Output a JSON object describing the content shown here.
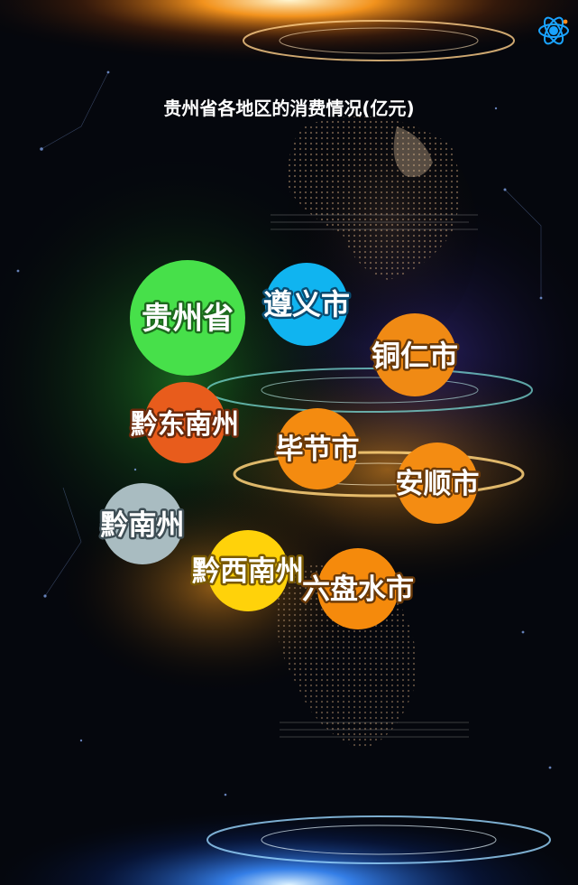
{
  "chart_data": {
    "type": "bubble",
    "title": "贵州省各地区的消费情况(亿元)",
    "series": [
      {
        "label": "贵州省",
        "color": "#47e04a",
        "stroke": "#1d6b1e"
      },
      {
        "label": "遵义市",
        "color": "#10b4f0",
        "stroke": "#0a4d73"
      },
      {
        "label": "铜仁市",
        "color": "#f08a14",
        "stroke": "#6b3a08"
      },
      {
        "label": "黔东南州",
        "color": "#e85c1c",
        "stroke": "#6b2a0c"
      },
      {
        "label": "毕节市",
        "color": "#f48b10",
        "stroke": "#6b3a08"
      },
      {
        "label": "安顺市",
        "color": "#f48c12",
        "stroke": "#6b3a08"
      },
      {
        "label": "黔南州",
        "color": "#a9bcc1",
        "stroke": "#3e4e55"
      },
      {
        "label": "黔西南州",
        "color": "#ffd20a",
        "stroke": "#7a5a00"
      },
      {
        "label": "六盘水市",
        "color": "#f58a0c",
        "stroke": "#6b3a08"
      }
    ]
  },
  "icons": {
    "top_right": "orbit-atom-icon"
  }
}
